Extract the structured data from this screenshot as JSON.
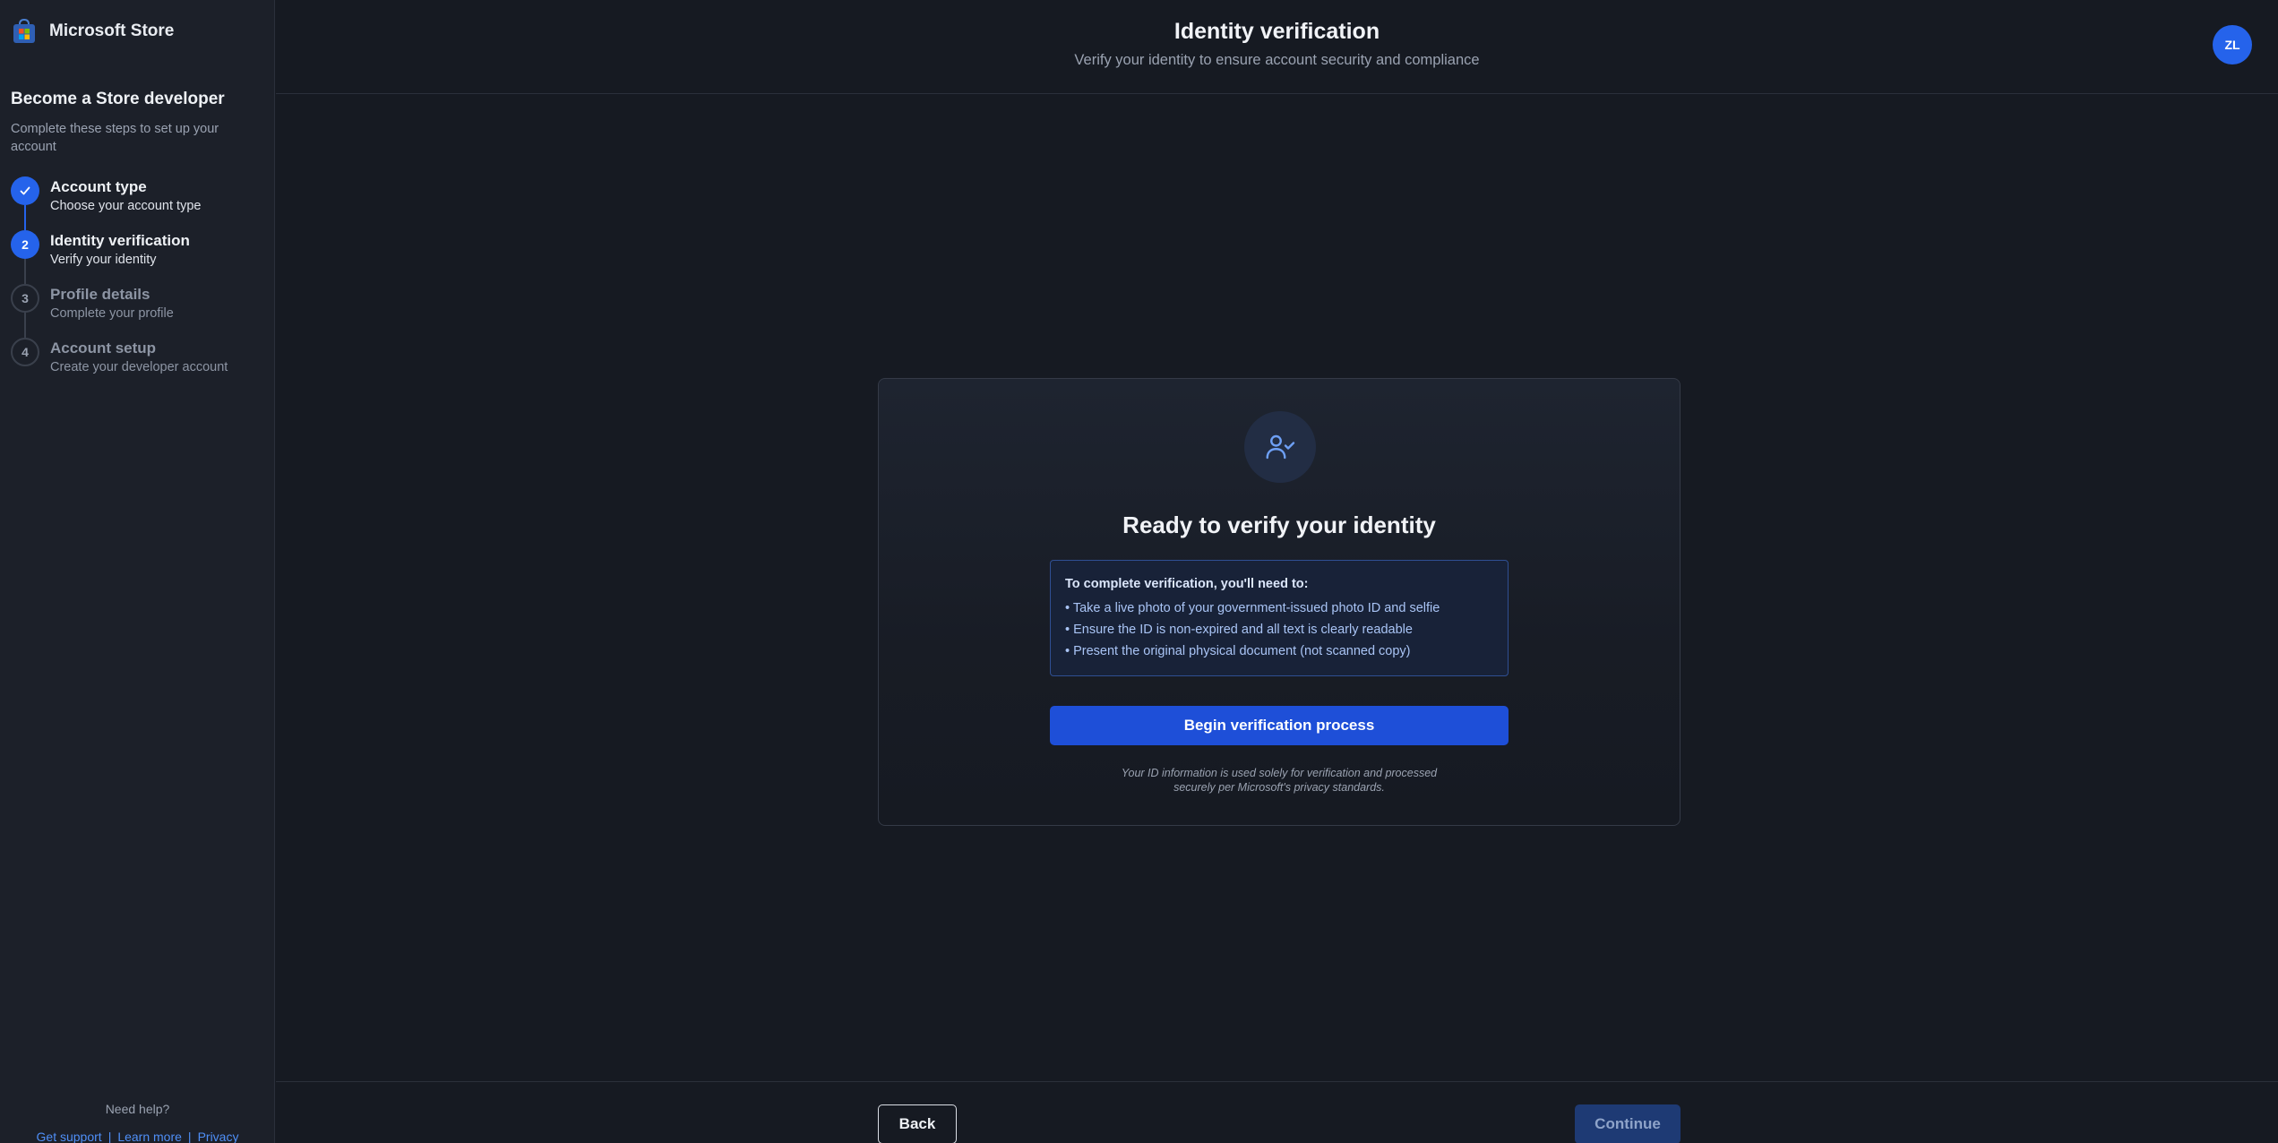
{
  "app": {
    "name": "Microsoft Store",
    "logo_icon": "microsoft-store-bag-icon"
  },
  "sidebar": {
    "title": "Become a Store developer",
    "subtitle": "Complete these steps to set up your account",
    "steps": [
      {
        "number": "1",
        "title": "Account type",
        "description": "Choose your account type",
        "state": "completed",
        "icon": "check-icon"
      },
      {
        "number": "2",
        "title": "Identity verification",
        "description": "Verify your identity",
        "state": "active"
      },
      {
        "number": "3",
        "title": "Profile details",
        "description": "Complete your profile",
        "state": "pending"
      },
      {
        "number": "4",
        "title": "Account setup",
        "description": "Create your developer account",
        "state": "pending"
      }
    ],
    "help": {
      "label": "Need help?",
      "links": [
        "Get support",
        "Learn more",
        "Privacy"
      ],
      "separator": "|"
    }
  },
  "header": {
    "title": "Identity verification",
    "subtitle": "Verify your identity to ensure account security and compliance",
    "avatar_initials": "ZL"
  },
  "card": {
    "icon": "user-check-icon",
    "title": "Ready to verify your identity",
    "requirements_title": "To complete verification, you'll need to:",
    "requirements": [
      "• Take a live photo of your government-issued photo ID and selfie",
      "• Ensure the ID is non-expired and all text is clearly readable",
      "• Present the original physical document (not scanned copy)"
    ],
    "begin_button": "Begin verification process",
    "privacy_note": "Your ID information is used solely for verification and processed securely per Microsoft's privacy standards."
  },
  "footer": {
    "back_label": "Back",
    "continue_label": "Continue",
    "continue_disabled": true
  },
  "colors": {
    "background": "#161a22",
    "sidebar": "#1c2029",
    "accent": "#2563eb",
    "primary_button": "#1e4fd8",
    "disabled_button": "#1e3a74",
    "link": "#4f8ff7"
  }
}
